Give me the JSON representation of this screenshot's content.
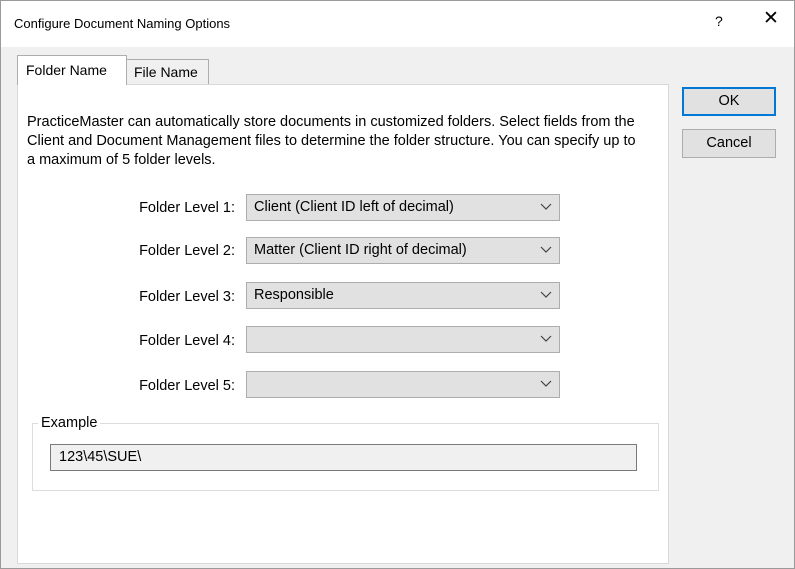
{
  "window": {
    "title": "Configure Document Naming Options",
    "help_glyph": "?",
    "close_glyph": "✕"
  },
  "tabs": [
    {
      "label": "Folder Name",
      "selected": true
    },
    {
      "label": "File Name",
      "selected": false
    }
  ],
  "intro_text": "PracticeMaster can automatically store documents in customized folders.  Select fields from the Client and Document Management files to determine the folder structure.  You can specify up to a maximum of 5 folder levels.",
  "folder_levels": [
    {
      "label": "Folder Level 1:",
      "value": "Client (Client ID left of decimal)"
    },
    {
      "label": "Folder Level 2:",
      "value": "Matter (Client ID right of decimal)"
    },
    {
      "label": "Folder Level 3:",
      "value": "Responsible"
    },
    {
      "label": "Folder Level 4:",
      "value": ""
    },
    {
      "label": "Folder Level 5:",
      "value": ""
    }
  ],
  "example": {
    "legend": "Example",
    "value": "123\\45\\SUE\\"
  },
  "buttons": {
    "ok": "OK",
    "cancel": "Cancel"
  },
  "colors": {
    "default_button_border": "#0078d7",
    "combo_background": "#e1e1e1"
  }
}
